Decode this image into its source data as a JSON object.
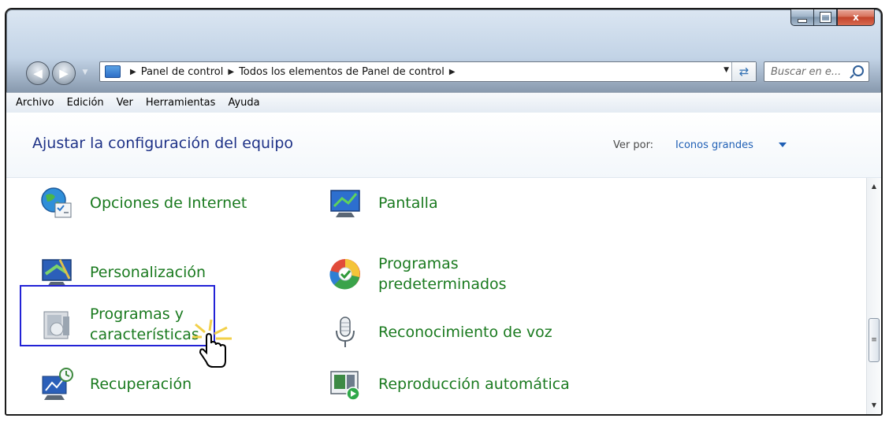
{
  "window": {
    "caption_buttons": {
      "close_label": "x"
    }
  },
  "address_bar": {
    "crumbs": [
      "Panel de control",
      "Todos los elementos de Panel de control"
    ],
    "search_placeholder": "Buscar en e..."
  },
  "menu": [
    "Archivo",
    "Edición",
    "Ver",
    "Herramientas",
    "Ayuda"
  ],
  "header": {
    "title": "Ajustar la configuración del equipo",
    "view_by_label": "Ver por:",
    "view_by_value": "Iconos grandes"
  },
  "items": [
    {
      "label": "Opciones de Internet",
      "icon": "internet-options-icon"
    },
    {
      "label": "Pantalla",
      "icon": "display-icon"
    },
    {
      "label": "Personalización",
      "icon": "personalization-icon"
    },
    {
      "label": "Programas predeterminados",
      "icon": "default-programs-icon"
    },
    {
      "label": "Programas y características",
      "icon": "programs-features-icon",
      "highlighted": true
    },
    {
      "label": "Reconocimiento de voz",
      "icon": "microphone-icon"
    },
    {
      "label": "Recuperación",
      "icon": "recovery-icon"
    },
    {
      "label": "Reproducción automática",
      "icon": "autoplay-icon"
    }
  ],
  "colors": {
    "item_text": "#1a7a1f",
    "title_text": "#1e3287",
    "highlight_border": "#2222d6"
  }
}
